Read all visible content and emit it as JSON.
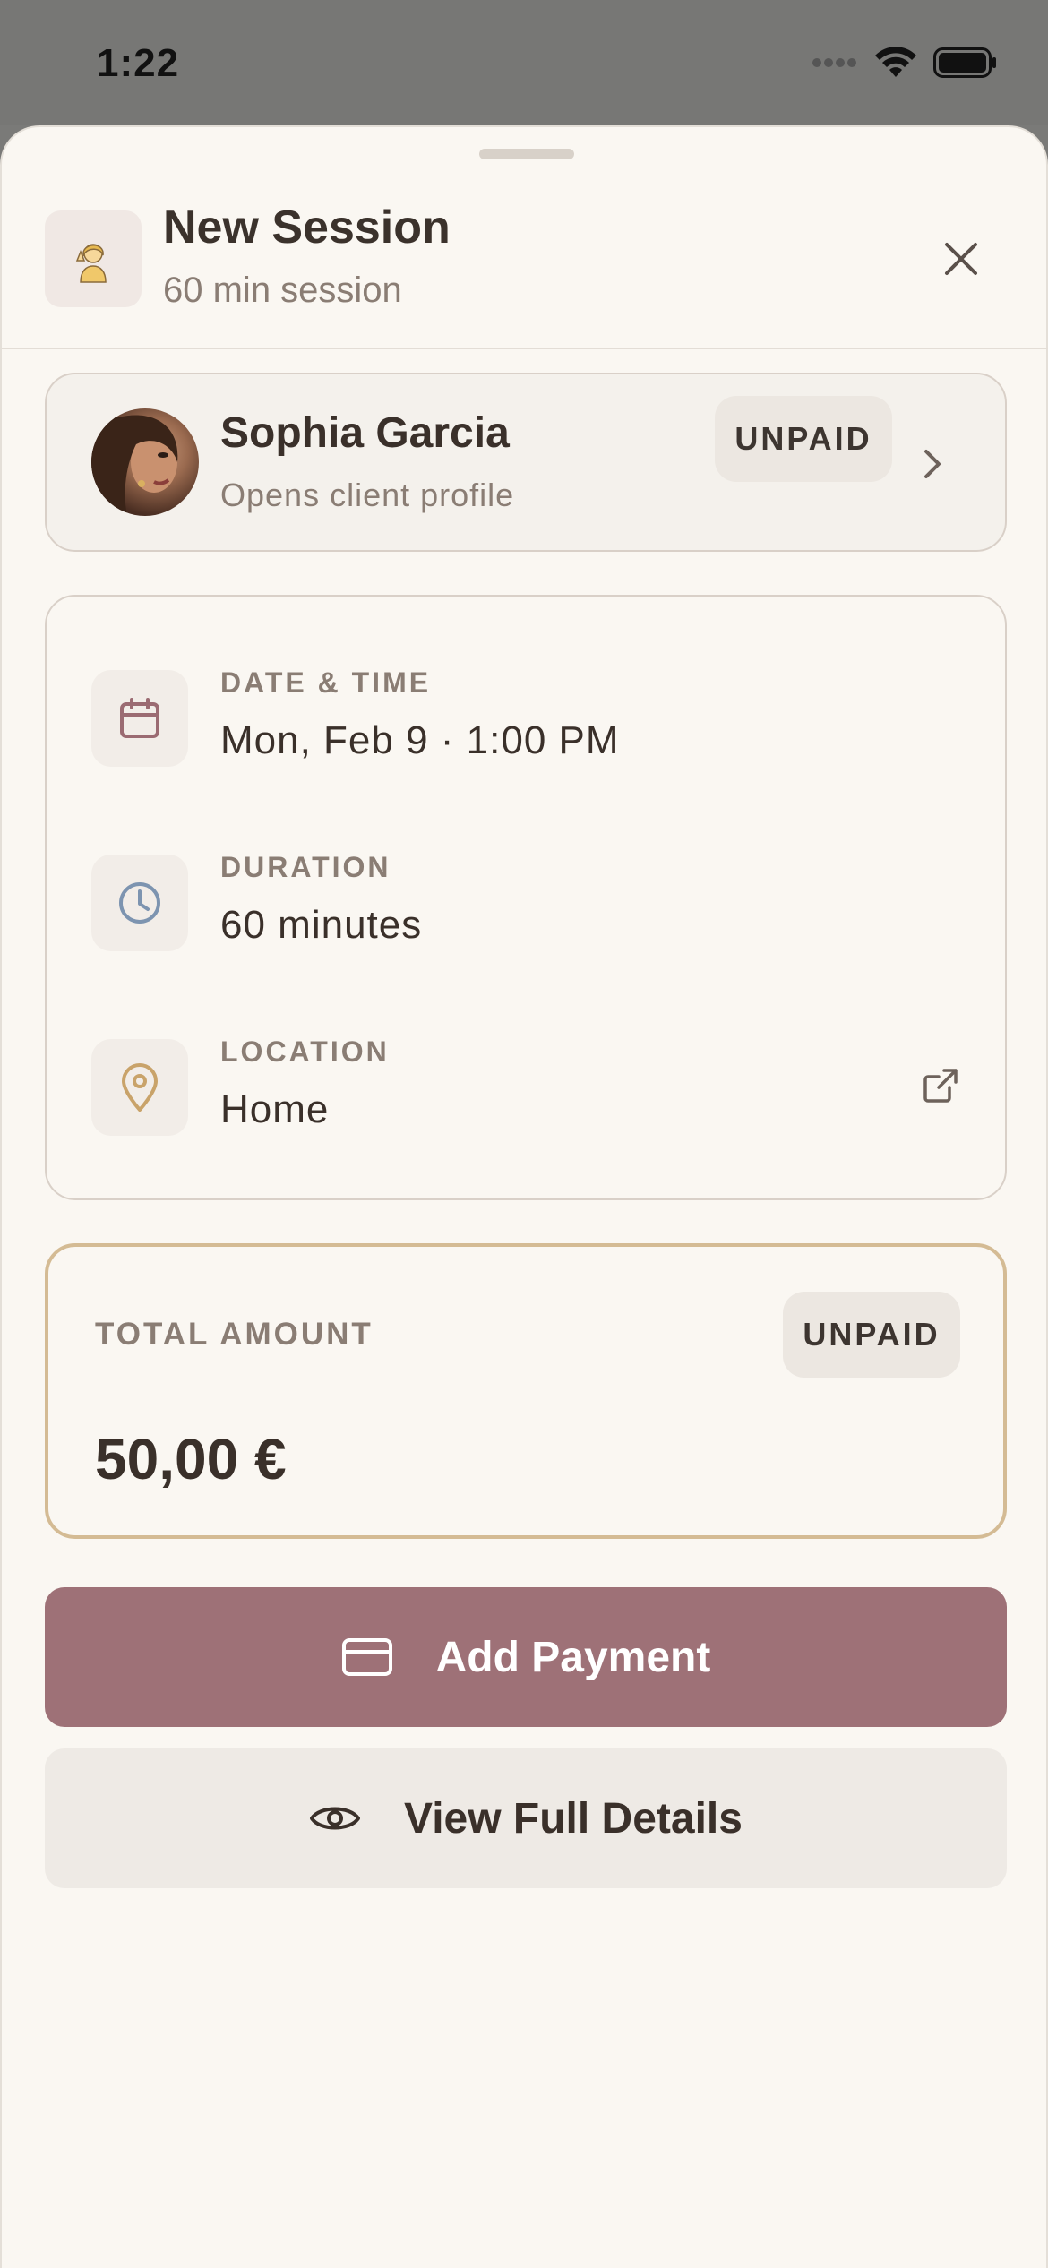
{
  "status_bar": {
    "time": "1:22"
  },
  "header": {
    "title": "New Session",
    "subtitle": "60 min session",
    "icon": "woman-emoji-icon"
  },
  "client": {
    "name": "Sophia Garcia",
    "subtitle": "Opens client profile",
    "status": "UNPAID"
  },
  "details": [
    {
      "label": "DATE & TIME",
      "value": "Mon, Feb 9 · 1:00 PM",
      "icon": "calendar-icon",
      "icon_color": "#9b6b72"
    },
    {
      "label": "DURATION",
      "value": "60 minutes",
      "icon": "clock-icon",
      "icon_color": "#7d94b0"
    },
    {
      "label": "LOCATION",
      "value": "Home",
      "icon": "map-pin-icon",
      "icon_color": "#c9a36a"
    }
  ],
  "amount": {
    "label": "TOTAL AMOUNT",
    "status": "UNPAID",
    "value": "50,00 €"
  },
  "actions": {
    "add_payment": "Add Payment",
    "view_details": "View Full Details"
  },
  "colors": {
    "primary": "#9e7177",
    "amount_border": "#d4bb94",
    "background": "#faf7f2"
  }
}
